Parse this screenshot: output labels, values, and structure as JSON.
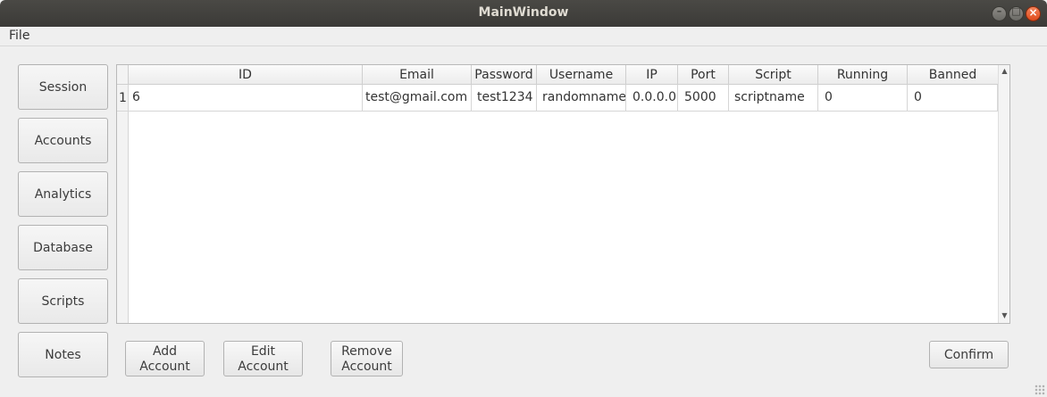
{
  "window": {
    "title": "MainWindow"
  },
  "menu": {
    "file": "File"
  },
  "sidebar": {
    "items": [
      "Session",
      "Accounts",
      "Analytics",
      "Database",
      "Scripts",
      "Notes"
    ]
  },
  "table": {
    "columns": [
      "ID",
      "Email",
      "Password",
      "Username",
      "IP",
      "Port",
      "Script",
      "Running",
      "Banned"
    ],
    "rows": [
      {
        "num": "1",
        "cells": [
          "6",
          "test@gmail.com",
          "test1234",
          "randomname",
          "0.0.0.0",
          "5000",
          "scriptname",
          "0",
          "0"
        ]
      }
    ]
  },
  "actions": {
    "add": "Add\nAccount",
    "edit": "Edit\nAccount",
    "remove": "Remove\nAccount",
    "confirm": "Confirm"
  },
  "colors": {
    "titlebar": "#3b3a37",
    "close": "#df4b1c",
    "background": "#efefef"
  }
}
